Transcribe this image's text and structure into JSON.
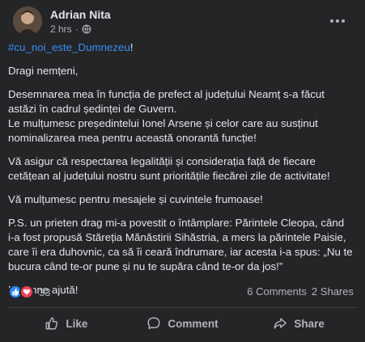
{
  "post": {
    "author": "Adrian Nita",
    "time": "2 hrs",
    "separator": "·",
    "audience_icon": "globe-icon",
    "more_icon": "more-options-icon"
  },
  "content": {
    "hashtag": "#cu_noi_este_Dumnezeu",
    "hashtag_suffix": "!",
    "greeting": "Dragi nemțeni,",
    "p1_l1": "Desemnarea mea în funcția de prefect al județului Neamț s-a făcut",
    "p1_l2": "astăzi în cadrul ședinței de Guvern.",
    "p1_l3": "Le mulțumesc președintelui Ionel Arsene și celor care au susținut",
    "p1_l4": "nominalizarea mea pentru această onorantă funcție!",
    "p2_l1": "Vă  asigur că respectarea legalității și considerația față de fiecare",
    "p2_l2": "cetățean al județului nostru sunt prioritățile fiecărei zile de activitate!",
    "p3": "Vă mulțumesc pentru mesajele și cuvintele frumoase!",
    "p4_l1": "P.S. un prieten drag mi-a povestit o  întâmplare: Părintele Cleopa, când",
    "p4_l2": "i-a fost propusă Stăreția Mănăstirii Sihăstria, a mers la părintele Paisie,",
    "p4_l3": "care îi era duhovnic, ca să îi ceară îndrumare, iar acesta i-a spus: „Nu te",
    "p4_l4": "bucura când te-or pune și nu te supăra când te-or da jos!”",
    "closing": "Doamne ajută!"
  },
  "engagement": {
    "reaction_count": "33",
    "comments": "6 Comments",
    "shares": "2 Shares"
  },
  "actions": {
    "like": "Like",
    "comment": "Comment",
    "share": "Share"
  },
  "colors": {
    "background": "#242526",
    "text": "#e4e6eb",
    "muted": "#b0b3b8",
    "link": "#3a8ef6",
    "like_blue": "#2d88ff",
    "love_red": "#f33e58"
  }
}
